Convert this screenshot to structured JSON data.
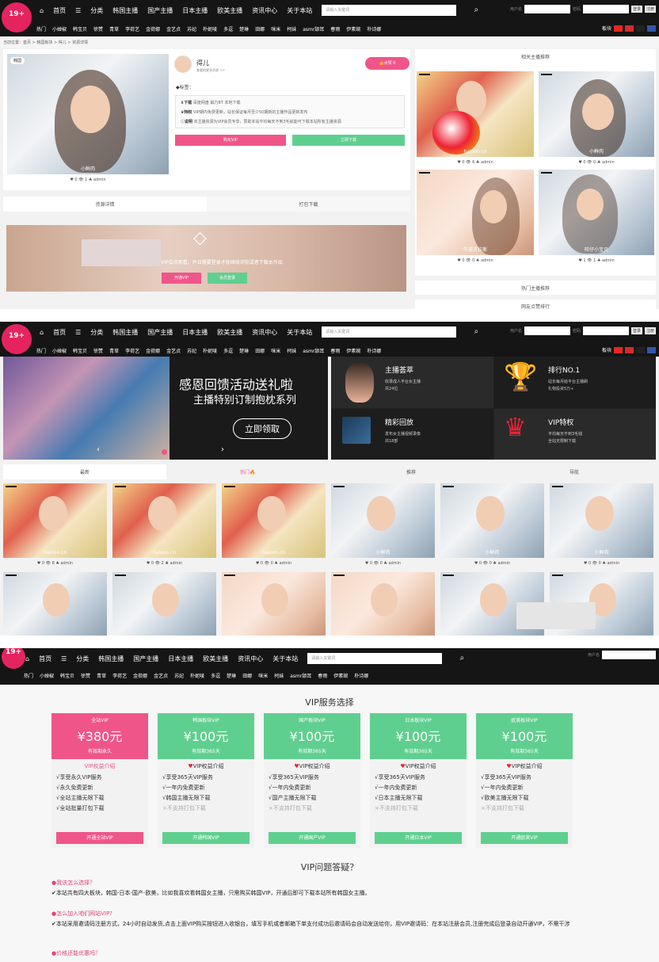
{
  "nav": {
    "logo": "19",
    "logo_sup": "+",
    "menu": [
      "首页",
      "分类",
      "韩国主播",
      "国产主播",
      "日本主播",
      "欧美主播",
      "资讯中心",
      "关于本站"
    ],
    "menu_icons": [
      "home-icon",
      "list-icon"
    ],
    "search_placeholder": "请输入关键词",
    "login_user": "用户名",
    "login_pass": "密码",
    "login_btn": "登录",
    "register_btn": "注册",
    "tags": [
      "热门",
      "小婵椒",
      "韩宝贝",
      "徐赞",
      "青草",
      "李荷艺",
      "金荷娜",
      "金艺贞",
      "苏妃",
      "朴妮唛",
      "多逗",
      "楚琳",
      "田娜",
      "咪米",
      "柯妹",
      "asmr舔耳",
      "春雨",
      "伊素婉",
      "朴诗娜"
    ],
    "version_label": "板块",
    "flags": [
      "#e8261f",
      "#cf2e2e",
      "#222",
      "#3355aa"
    ]
  },
  "detail": {
    "breadcrumb": "当前位置：首页 > 韩国板块 > 得儿 > 资源详情",
    "badge": "韩国",
    "image_caption": "小鲜肉",
    "image_meta": "♥ 0  👁 1  ♣ admin",
    "author_name": "得儿",
    "author_desc": "查看他更多资源 >>",
    "follow_btn": "点赞 0",
    "tags_label": "标签：",
    "download_title": "下载",
    "download_desc": "百度网盘 磁力BT 本地下载",
    "vip_title": "特权",
    "vip_desc": "VIP期内免费更新，站长保证每月至少50期新的主播作品更新发布",
    "note_title": "说明",
    "note_desc": "本主播资源为VIP会员专享，赞助本站平均每天不到3毛就能可下载本站所有主播资源",
    "buy_btn": "购买VIP",
    "download_btn": "立即下载",
    "tab_detail": "资源详情",
    "tab_download": "打包下载",
    "locked_text": "本帖仅限VIP会员观看，并且需要登录才能继续浏览或者下载本作品",
    "open_vip_btn": "开通VIP",
    "member_login_btn": "会员登录",
    "side_title": "相关主播推荐",
    "side_items": [
      {
        "caption": "halooo.cn",
        "meta": "♥ 0  👁 6  ♣ admin"
      },
      {
        "caption": "小鲜肉",
        "meta": "♥ 0  👁 0  ♣ admin"
      },
      {
        "caption": "牛逼克拉斯",
        "meta": "♥ 0  👁 0  ♣ admin"
      },
      {
        "caption": "旺仔小宝贝",
        "meta": "♥ 1  👁 1  ♣ admin"
      }
    ],
    "side_hot": "热门主播推荐",
    "side_rank": "网友点赞排行"
  },
  "home": {
    "banner_title": "感恩回馈活动送礼啦",
    "banner_sub": "主播特别订制抱枕系列",
    "banner_btn": "立即领取",
    "features": [
      {
        "title": "主播荟萃",
        "desc1": "收录成人平台女主播",
        "desc2": "共24位"
      },
      {
        "title": "排行NO.1",
        "desc1": "站长每月给平台主播刷",
        "desc2": "礼物投资5万+"
      },
      {
        "title": "精彩回放",
        "desc1": "发布女主播视频录像",
        "desc2": "共18部"
      },
      {
        "title": "VIP特权",
        "desc1": "平均每天不到3毛钱",
        "desc2": "全站无限制下载"
      }
    ],
    "tabs": [
      "最新",
      "热门🔥",
      "推荐",
      "导航"
    ],
    "grid_captions": [
      "halooo.cn",
      "halooo.cn",
      "halooo.cn",
      "小鲜肉",
      "小鲜肉",
      "小鲜肉"
    ],
    "grid_meta": [
      "♥ 0  👁 8  ♣ admin",
      "♥ 0  👁 2  ♣ admin",
      "♥ 0  👁 0  ♣ admin",
      "♥ 0  👁 0  ♣ admin",
      "♥ 0  👁 0  ♣ admin",
      "♥ 0  👁 0  ♣ admin"
    ]
  },
  "vip": {
    "title": "VIP服务选择",
    "cards": [
      {
        "name": "全站VIP",
        "price": "¥380元",
        "period": "有效期永久",
        "sub": "VIP权益介绍",
        "color": "#f0558a",
        "items": [
          "√享受永久VIP服务",
          "√永久免费更新",
          "√全站主播无限下载",
          "√全站批量打包下载"
        ],
        "disabled": [
          false,
          false,
          false,
          false
        ],
        "btn": "开通全站VIP"
      },
      {
        "name": "韩国板块VIP",
        "price": "¥100元",
        "period": "有效期365天",
        "sub": "VIP权益介绍",
        "color": "#5fcf8f",
        "items": [
          "√享受365天VIP服务",
          "√一年内免费更新",
          "√韩国主播无限下载",
          "×不支持打包下载"
        ],
        "disabled": [
          false,
          false,
          false,
          true
        ],
        "btn": "开通韩国VIP"
      },
      {
        "name": "国产板块VIP",
        "price": "¥100元",
        "period": "有效期365天",
        "sub": "VIP权益介绍",
        "color": "#5fcf8f",
        "items": [
          "√享受365天VIP服务",
          "√一年内免费更新",
          "√国产主播无限下载",
          "×不支持打包下载"
        ],
        "disabled": [
          false,
          false,
          false,
          true
        ],
        "btn": "开通国产VIP"
      },
      {
        "name": "日本板块VIP",
        "price": "¥100元",
        "period": "有效期365天",
        "sub": "VIP权益介绍",
        "color": "#5fcf8f",
        "items": [
          "√享受365天VIP服务",
          "√一年内免费更新",
          "√日本主播无限下载",
          "×不支持打包下载"
        ],
        "disabled": [
          false,
          false,
          false,
          true
        ],
        "btn": "开通日本VIP"
      },
      {
        "name": "欧美板块VIP",
        "price": "¥100元",
        "period": "有效期365天",
        "sub": "VIP权益介绍",
        "color": "#5fcf8f",
        "items": [
          "√享受365天VIP服务",
          "√一年内免费更新",
          "√欧美主播无限下载",
          "×不支持打包下载"
        ],
        "disabled": [
          false,
          false,
          false,
          true
        ],
        "btn": "开通欧美VIP"
      }
    ],
    "faq_title": "VIP问题答疑？",
    "faq": [
      {
        "q": "我该怎么选择？",
        "a": "✔本站共有四大板块，韩国-日本-国产-欧美，比如我喜欢看韩国女主播，只需购买韩国VIP，开通后即可下载本站所有韩国女主播。"
      },
      {
        "q": "怎么加入咱们网站VIP?",
        "a": "✔本站采用邀请码注册方式，24小时自动发货,点击上面VIP购买按钮进入收银台，填写手机或者邮箱下单支付成功后邀请码会自动发送给你，用VIP邀请码：在本站注册会员,注册完成后登录自动开通VIP，不需干涉"
      },
      {
        "q": "价格还能优惠吗？",
        "a": ""
      }
    ]
  }
}
